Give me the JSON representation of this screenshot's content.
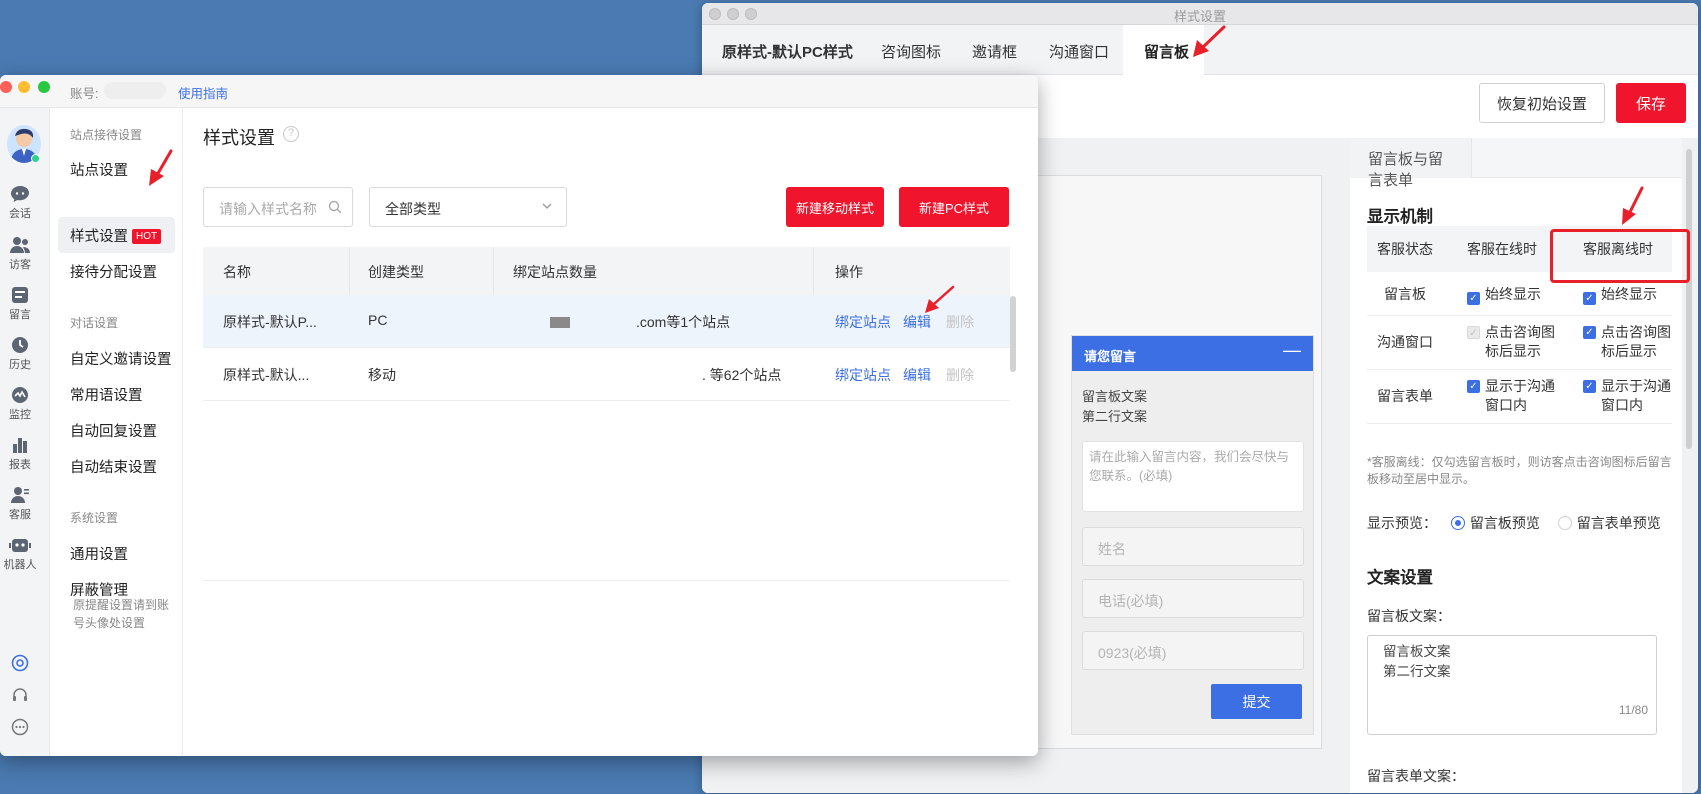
{
  "back_window": {
    "title": "样式设置",
    "tabs": [
      "原样式-默认PC样式",
      "咨询图标",
      "邀请框",
      "沟通窗口",
      "留言板"
    ],
    "active_tab": "留言板",
    "reset_button": "恢复初始设置",
    "save_button": "保存",
    "widget": {
      "header": "请您留言",
      "minimize": "—",
      "line1": "留言板文案",
      "line2": "第二行文案",
      "textarea_placeholder": "请在此输入留言内容，我们会尽快与您联系。(必填)",
      "name_placeholder": "姓名",
      "phone_placeholder": "电话(必填)",
      "third_field": "0923(必填)",
      "submit": "提交"
    },
    "settings": {
      "tab": "留言板与留言表单",
      "display_heading": "显示机制",
      "table_header": [
        "客服状态",
        "客服在线时",
        "客服离线时"
      ],
      "rows": [
        {
          "label": "留言板",
          "online": "始终显示",
          "offline": "始终显示"
        },
        {
          "label": "沟通窗口",
          "online": "点击咨询图标后显示",
          "offline": "点击咨询图标后显示"
        },
        {
          "label": "留言表单",
          "online": "显示于沟通窗口内",
          "offline": "显示于沟通窗口内"
        }
      ],
      "note": "*客服离线：仅勾选留言板时，则访客点击咨询图标后留言板移动至居中显示。",
      "preview_label": "显示预览：",
      "preview_options": [
        "留言板预览",
        "留言表单预览"
      ],
      "preview_selected": "留言板预览",
      "copy_heading": "文案设置",
      "board_copy_label": "留言板文案：",
      "board_copy_lines": [
        "留言板文案",
        "第二行文案"
      ],
      "board_copy_count": "11/80",
      "form_copy_label": "留言表单文案："
    }
  },
  "front_window": {
    "account_label": "账号:",
    "guide_link": "使用指南",
    "rail": [
      "会话",
      "访客",
      "留言",
      "历史",
      "监控",
      "报表",
      "客服",
      "机器人"
    ],
    "subnav": {
      "group1": "站点接待设置",
      "items1": [
        "站点设置",
        "样式设置",
        "接待分配设置"
      ],
      "hot_badge": "HOT",
      "group2": "对话设置",
      "items2": [
        "自定义邀请设置",
        "常用语设置",
        "自动回复设置",
        "自动结束设置"
      ],
      "group3": "系统设置",
      "items3": [
        "通用设置",
        "屏蔽管理"
      ],
      "note": "原提醒设置请到账号头像处设置"
    },
    "main": {
      "title": "样式设置",
      "search_placeholder": "请输入样式名称",
      "type_select": "全部类型",
      "new_mobile": "新建移动样式",
      "new_pc": "新建PC样式",
      "columns": [
        "名称",
        "创建类型",
        "绑定站点数量",
        "操作"
      ],
      "rows": [
        {
          "name": "原样式-默认P...",
          "type": "PC",
          "sites": ".com等1个站点",
          "bind": "绑定站点",
          "edit": "编辑",
          "delete": "删除"
        },
        {
          "name": "原样式-默认...",
          "type": "移动",
          "sites": ". 等62个站点",
          "bind": "绑定站点",
          "edit": "编辑",
          "delete": "删除"
        }
      ]
    }
  },
  "colors": {
    "accent_blue": "#3c6fe4",
    "brand_red": "#f0142c",
    "annotation_red": "#e8202a",
    "desktop": "#4a7ab1"
  }
}
